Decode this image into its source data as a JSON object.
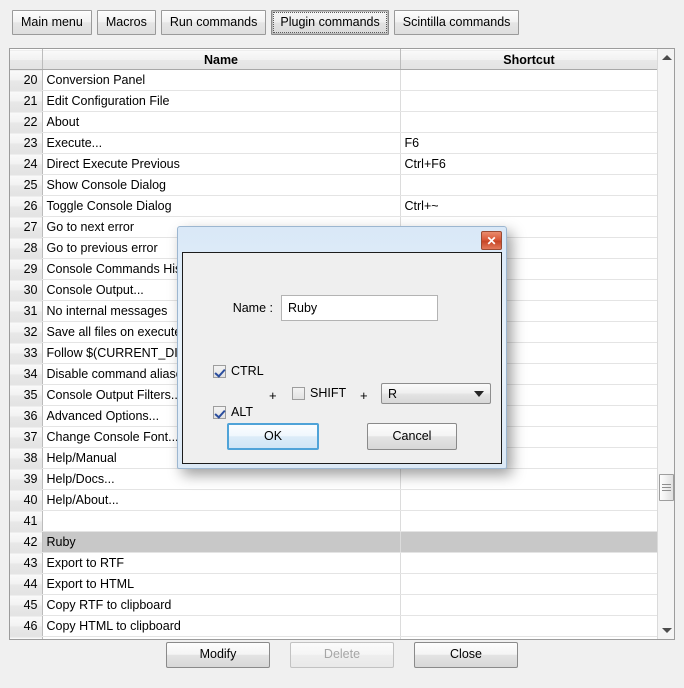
{
  "tabs": [
    {
      "label": "Main menu",
      "selected": false
    },
    {
      "label": "Macros",
      "selected": false
    },
    {
      "label": "Run commands",
      "selected": false
    },
    {
      "label": "Plugin commands",
      "selected": true
    },
    {
      "label": "Scintilla commands",
      "selected": false
    }
  ],
  "table": {
    "headers": {
      "num": "",
      "name": "Name",
      "shortcut": "Shortcut"
    },
    "rows": [
      {
        "num": "20",
        "name": "Conversion Panel",
        "shortcut": "",
        "selected": false
      },
      {
        "num": "21",
        "name": "Edit Configuration File",
        "shortcut": "",
        "selected": false
      },
      {
        "num": "22",
        "name": "About",
        "shortcut": "",
        "selected": false
      },
      {
        "num": "23",
        "name": "Execute...",
        "shortcut": "F6",
        "selected": false
      },
      {
        "num": "24",
        "name": "Direct Execute Previous",
        "shortcut": "Ctrl+F6",
        "selected": false
      },
      {
        "num": "25",
        "name": "Show Console Dialog",
        "shortcut": "",
        "selected": false
      },
      {
        "num": "26",
        "name": "Toggle Console Dialog",
        "shortcut": "Ctrl+~",
        "selected": false
      },
      {
        "num": "27",
        "name": "Go to next error",
        "shortcut": "",
        "selected": false
      },
      {
        "num": "28",
        "name": "Go to previous error",
        "shortcut": "",
        "selected": false
      },
      {
        "num": "29",
        "name": "Console Commands History",
        "shortcut": "",
        "selected": false
      },
      {
        "num": "30",
        "name": "Console Output...",
        "shortcut": "",
        "selected": false
      },
      {
        "num": "31",
        "name": "No internal messages",
        "shortcut": "",
        "selected": false
      },
      {
        "num": "32",
        "name": "Save all files on execute",
        "shortcut": "",
        "selected": false
      },
      {
        "num": "33",
        "name": "Follow $(CURRENT_DIRECTORY)",
        "shortcut": "",
        "selected": false
      },
      {
        "num": "34",
        "name": "Disable command aliases",
        "shortcut": "",
        "selected": false
      },
      {
        "num": "35",
        "name": "Console Output Filters...",
        "shortcut": "",
        "selected": false
      },
      {
        "num": "36",
        "name": "Advanced Options...",
        "shortcut": "",
        "selected": false
      },
      {
        "num": "37",
        "name": "Change Console Font...",
        "shortcut": "",
        "selected": false
      },
      {
        "num": "38",
        "name": "Help/Manual",
        "shortcut": "",
        "selected": false
      },
      {
        "num": "39",
        "name": "Help/Docs...",
        "shortcut": "",
        "selected": false
      },
      {
        "num": "40",
        "name": "Help/About...",
        "shortcut": "",
        "selected": false
      },
      {
        "num": "41",
        "name": "",
        "shortcut": "",
        "selected": false
      },
      {
        "num": "42",
        "name": "Ruby",
        "shortcut": "",
        "selected": true
      },
      {
        "num": "43",
        "name": "Export to RTF",
        "shortcut": "",
        "selected": false
      },
      {
        "num": "44",
        "name": "Export to HTML",
        "shortcut": "",
        "selected": false
      },
      {
        "num": "45",
        "name": "Copy RTF to clipboard",
        "shortcut": "",
        "selected": false
      },
      {
        "num": "46",
        "name": "Copy HTML to clipboard",
        "shortcut": "",
        "selected": false
      },
      {
        "num": "",
        "name": "",
        "shortcut": "",
        "selected": false
      }
    ]
  },
  "scrollbar": {
    "up_icon": "triangle-up-icon",
    "down_icon": "triangle-down-icon",
    "thumb_icon": "scrollbar-grip"
  },
  "footer": {
    "modify_label": "Modify",
    "delete_label": "Delete",
    "delete_disabled": true,
    "close_label": "Close"
  },
  "dialog": {
    "title": "",
    "close_icon": "✕",
    "name_label": "Name :",
    "name_value": "Ruby",
    "name_placeholder": "",
    "ctrl": {
      "label": "CTRL",
      "checked": true
    },
    "alt": {
      "label": "ALT",
      "checked": true
    },
    "shift": {
      "label": "SHIFT",
      "checked": false
    },
    "plus1": "+",
    "plus2": "+",
    "key_value": "R",
    "key_options": [
      "R"
    ],
    "ok_label": "OK",
    "cancel_label": "Cancel"
  },
  "colors": {
    "accent": "#4fa3d8",
    "titlebar": "#d9e8f7",
    "close_button": "#d9593a",
    "selection": "#c8c8c8",
    "window_bg": "#f0f0f0"
  }
}
